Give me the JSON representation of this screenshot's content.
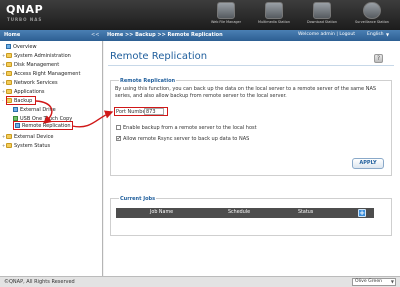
{
  "app": {
    "logo": "QNAP",
    "logo_sub": "TURBO NAS"
  },
  "stations": [
    {
      "label": "Web File Manager",
      "icon": "folder-icon"
    },
    {
      "label": "Multimedia Station",
      "icon": "multimedia-icon"
    },
    {
      "label": "Download Station",
      "icon": "download-icon"
    },
    {
      "label": "Surveillance Station",
      "icon": "camera-icon"
    }
  ],
  "header": {
    "home": "Home",
    "collapse": "<<",
    "breadcrumb": "Home >> Backup >> Remote Replication",
    "welcome": "Welcome admin | Logout",
    "language": "English"
  },
  "sidebar": {
    "items": [
      {
        "label": "Overview",
        "expander": ""
      },
      {
        "label": "System Administration",
        "expander": "+"
      },
      {
        "label": "Disk Management",
        "expander": "+"
      },
      {
        "label": "Access Right Management",
        "expander": "+"
      },
      {
        "label": "Network Services",
        "expander": "+"
      },
      {
        "label": "Applications",
        "expander": "+"
      },
      {
        "label": "Backup",
        "expander": "-"
      },
      {
        "label": "External Drive",
        "expander": ""
      },
      {
        "label": "USB One Touch Copy",
        "expander": ""
      },
      {
        "label": "Remote Replication",
        "expander": ""
      },
      {
        "label": "External Device",
        "expander": "+"
      },
      {
        "label": "System Status",
        "expander": "+"
      }
    ]
  },
  "main": {
    "title": "Remote Replication",
    "section_legend": "Remote Replication",
    "description": "By using this function, you can back up the data on the local server to a remote server of the same NAS series, and also allow backup from remote server to the local server.",
    "port_label": "Port Number:",
    "port_value": "873",
    "enable_backup_label": "Enable backup from a remote server to the local host",
    "allow_rsync_label": "Allow remote Rsync server to back up data to NAS",
    "apply_label": "APPLY",
    "current_jobs_legend": "Current Jobs",
    "jobs_columns": [
      "Job Name",
      "Schedule",
      "Status"
    ]
  },
  "footer": {
    "copyright": "©QNAP, All Rights Reserved",
    "theme": "Olive Green"
  },
  "colors": {
    "accent": "#1f5e9c",
    "highlight": "#d01818"
  }
}
